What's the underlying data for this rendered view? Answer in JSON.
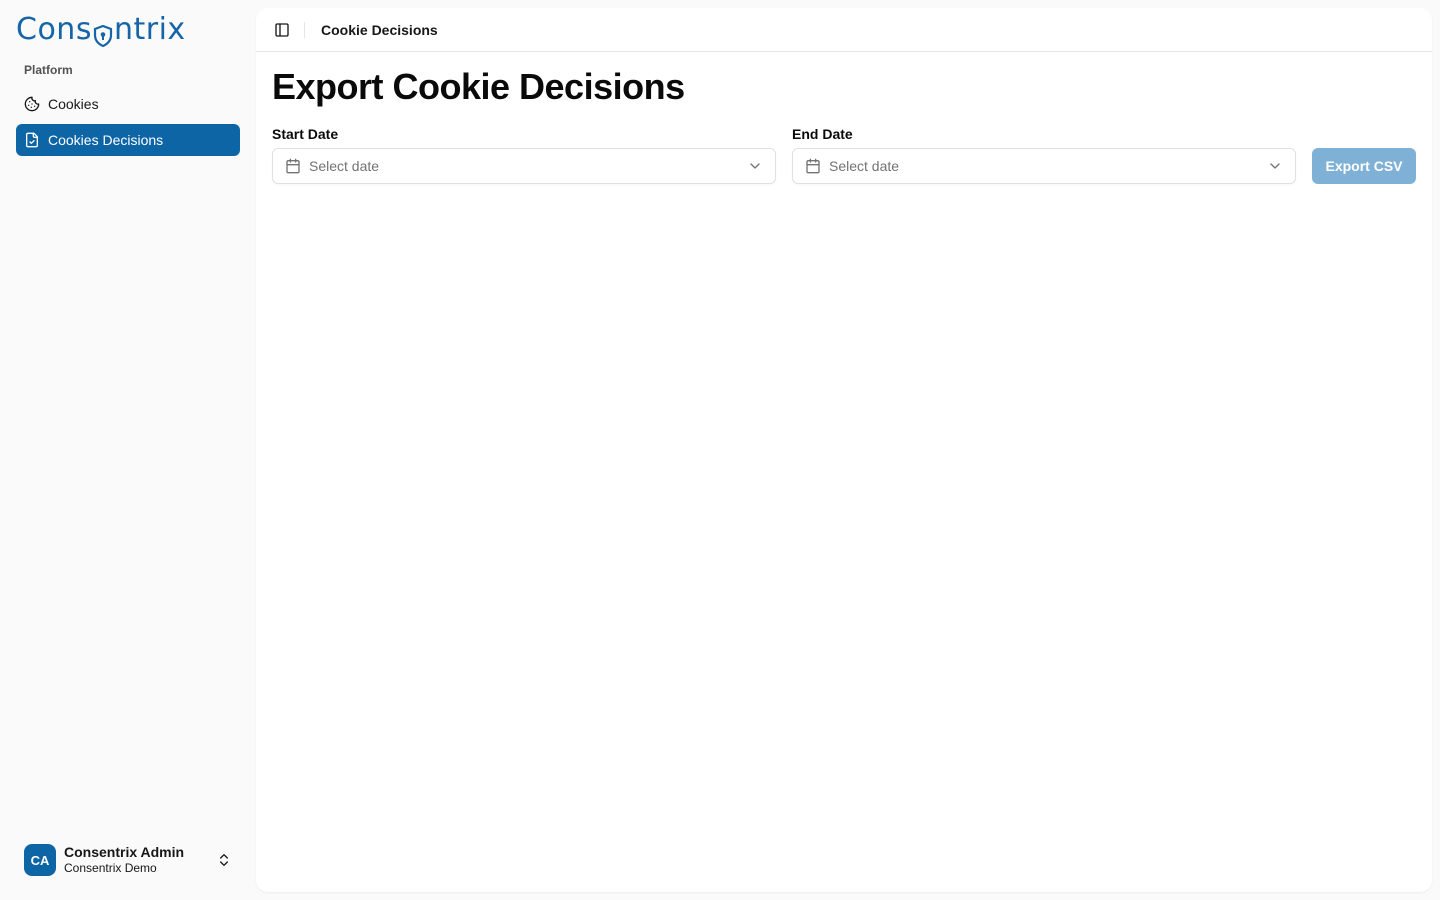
{
  "brand": {
    "name_prefix": "Cons",
    "name_suffix": "ntrix",
    "color": "#1565a8"
  },
  "sidebar": {
    "group_label": "Platform",
    "items": [
      {
        "label": "Cookies",
        "icon": "cookie-icon",
        "active": false
      },
      {
        "label": "Cookies Decisions",
        "icon": "file-check-icon",
        "active": true
      }
    ],
    "user": {
      "initials": "CA",
      "name": "Consentrix Admin",
      "org": "Consentrix Demo"
    }
  },
  "header": {
    "breadcrumb": "Cookie Decisions"
  },
  "main": {
    "title": "Export Cookie Decisions",
    "start_date": {
      "label": "Start Date",
      "placeholder": "Select date"
    },
    "end_date": {
      "label": "End Date",
      "placeholder": "Select date"
    },
    "export_button": "Export CSV"
  },
  "colors": {
    "accent": "#0d65a6",
    "export_disabled": "#7fb1d6"
  }
}
